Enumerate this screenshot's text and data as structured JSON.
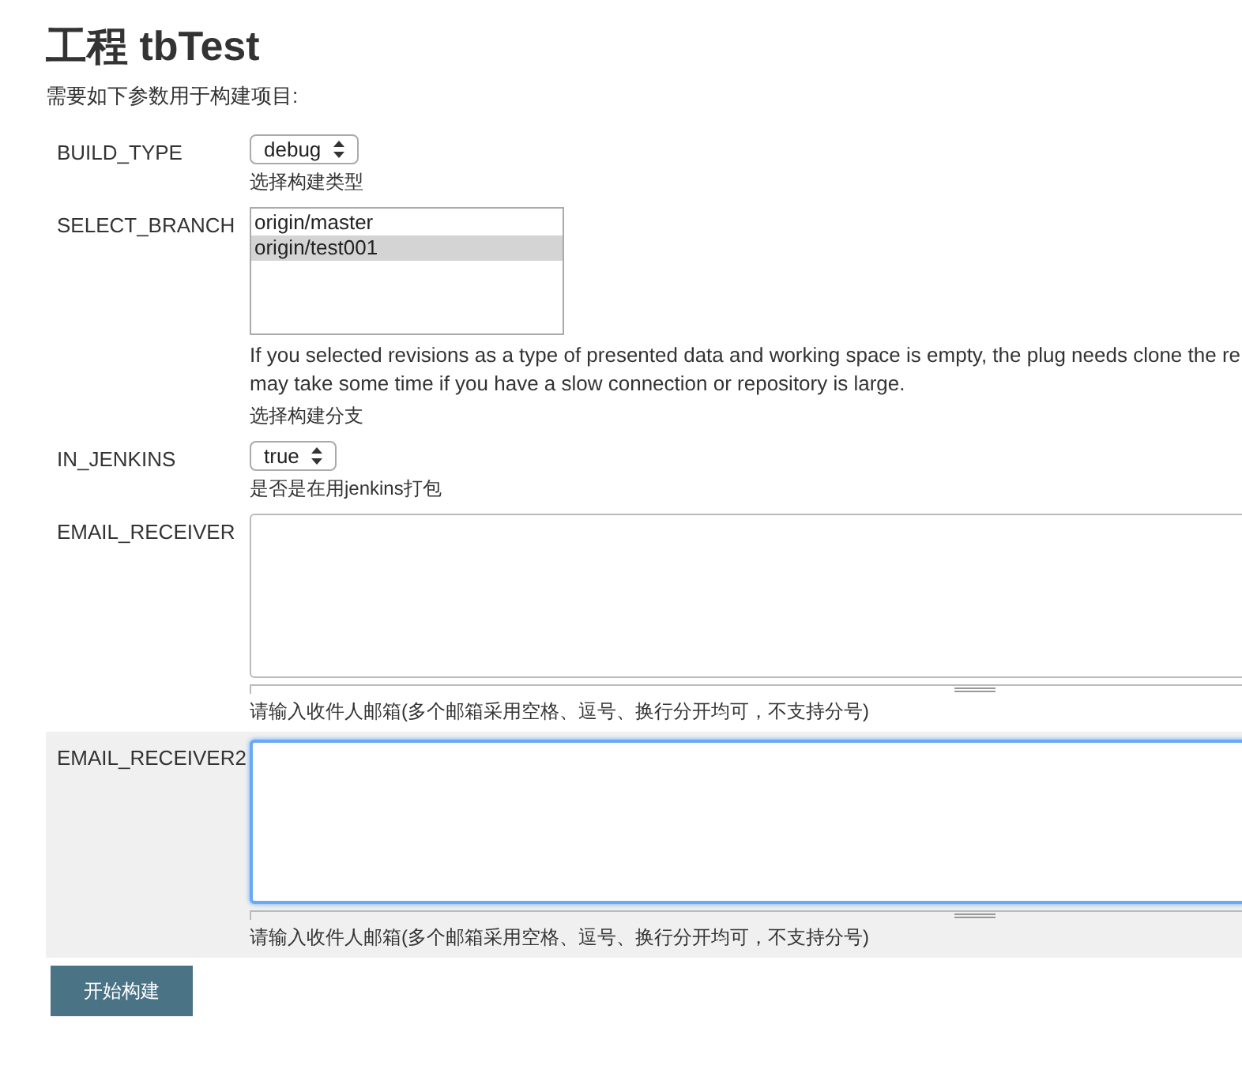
{
  "title": "工程 tbTest",
  "intro": "需要如下参数用于构建项目:",
  "parameters": [
    {
      "kind": "select",
      "name": "BUILD_TYPE",
      "value": "debug",
      "help": "选择构建类型",
      "highlighted": false
    },
    {
      "kind": "listbox",
      "name": "SELECT_BRANCH",
      "options": [
        {
          "label": "origin/master",
          "selected": false
        },
        {
          "label": "origin/test001",
          "selected": true
        }
      ],
      "description_lines": [
        "If you selected revisions as a type of presented data and working space is empty, the plug needs clone the re",
        "may take some time if you have a slow connection or repository is large."
      ],
      "help": "选择构建分支",
      "highlighted": false
    },
    {
      "kind": "select",
      "name": "IN_JENKINS",
      "value": "true",
      "help": "是否是在用jenkins打包",
      "highlighted": false
    },
    {
      "kind": "textarea",
      "name": "EMAIL_RECEIVER",
      "focused": false,
      "help": "请输入收件人邮箱(多个邮箱采用空格、逗号、换行分开均可，不支持分号)",
      "highlighted": false
    },
    {
      "kind": "textarea",
      "name": "EMAIL_RECEIVER2",
      "focused": true,
      "help": "请输入收件人邮箱(多个邮箱采用空格、逗号、换行分开均可，不支持分号)",
      "highlighted": true
    }
  ],
  "submit": "开始构建"
}
